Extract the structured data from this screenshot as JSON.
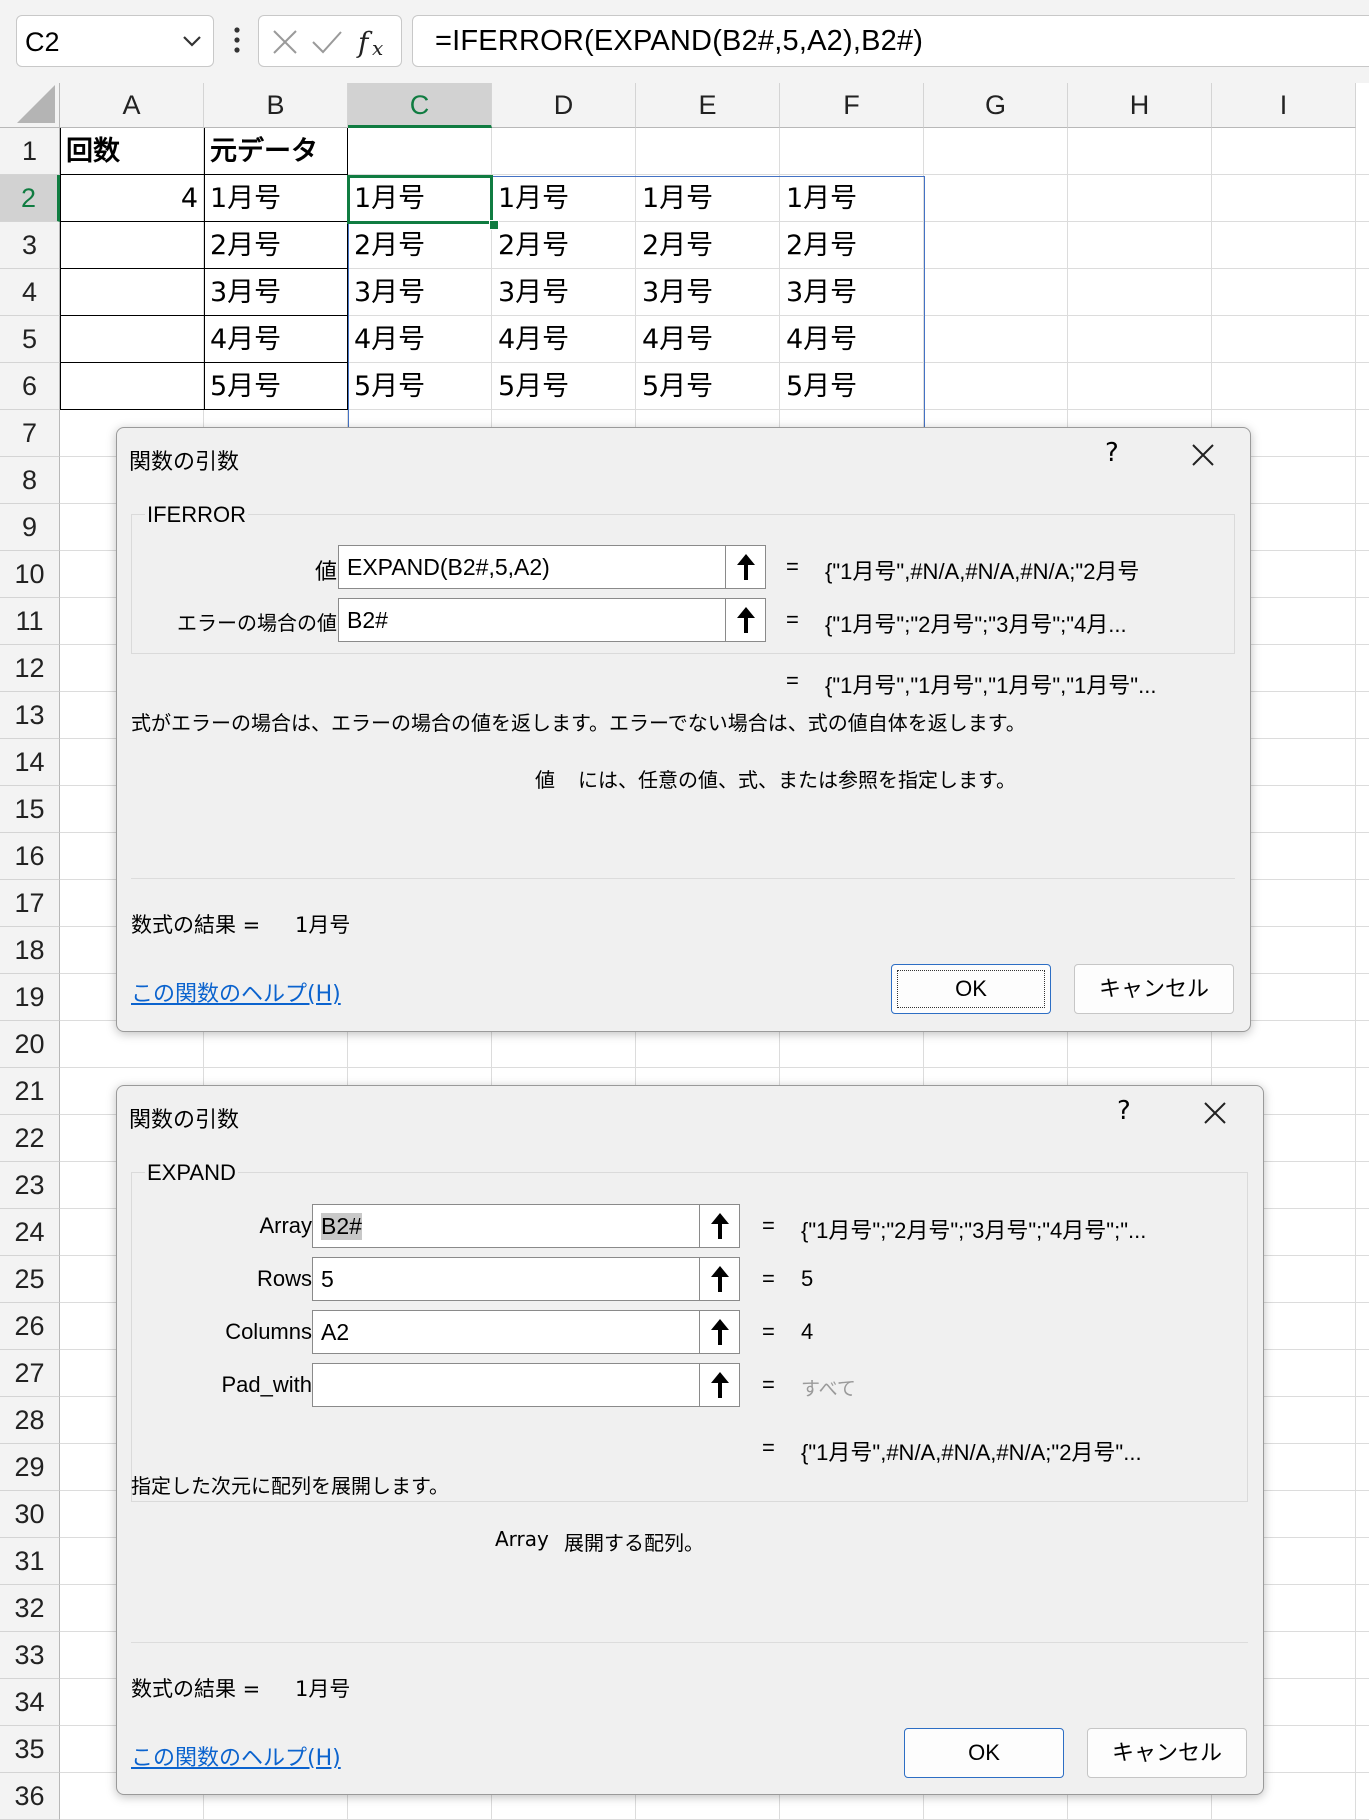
{
  "formula_bar": {
    "name_box": "C2",
    "formula": "=IFERROR(EXPAND(B2#,5,A2),B2#)"
  },
  "columns": [
    "A",
    "B",
    "C",
    "D",
    "E",
    "F",
    "G",
    "H",
    "I"
  ],
  "rows": [
    "1",
    "2",
    "3",
    "4",
    "5",
    "6",
    "7",
    "8",
    "9",
    "10",
    "11",
    "12",
    "13",
    "14",
    "15",
    "16",
    "17",
    "18",
    "19",
    "20",
    "21",
    "22",
    "23",
    "24",
    "25",
    "26",
    "27",
    "28",
    "29",
    "30",
    "31",
    "32",
    "33",
    "34",
    "35",
    "36"
  ],
  "cells": {
    "A1": "回数",
    "B1": "元データ",
    "A2": "4",
    "B2": "1月号",
    "B3": "2月号",
    "B4": "3月号",
    "B5": "4月号",
    "B6": "5月号",
    "spill": [
      [
        "1月号",
        "1月号",
        "1月号",
        "1月号"
      ],
      [
        "2月号",
        "2月号",
        "2月号",
        "2月号"
      ],
      [
        "3月号",
        "3月号",
        "3月号",
        "3月号"
      ],
      [
        "4月号",
        "4月号",
        "4月号",
        "4月号"
      ],
      [
        "5月号",
        "5月号",
        "5月号",
        "5月号"
      ]
    ]
  },
  "dialog1": {
    "title": "関数の引数",
    "help_q": "?",
    "function_name": "IFERROR",
    "args": [
      {
        "label": "値",
        "value": "EXPAND(B2#,5,A2)",
        "eq": "=",
        "result": "{\"1月号\",#N/A,#N/A,#N/A;\"2月号"
      },
      {
        "label": "エラーの場合の値",
        "value": "B2#",
        "eq": "=",
        "result": "{\"1月号\";\"2月号\";\"3月号\";\"4月..."
      }
    ],
    "total_eq": "=",
    "total_result": "{\"1月号\",\"1月号\",\"1月号\",\"1月号\"...",
    "description": "式がエラーの場合は、エラーの場合の値を返します。エラーでない場合は、式の値自体を返します。",
    "arg_desc_name": "値",
    "arg_desc_text": "には、任意の値、式、または参照を指定します。",
    "result_label": "数式の結果 =",
    "result_value": "1月号",
    "help_link": "この関数のヘルプ(H)",
    "ok": "OK",
    "cancel": "キャンセル"
  },
  "dialog2": {
    "title": "関数の引数",
    "help_q": "?",
    "function_name": "EXPAND",
    "args": [
      {
        "label": "Array",
        "value": "B2#",
        "eq": "=",
        "result": "{\"1月号\";\"2月号\";\"3月号\";\"4月号\";\"..."
      },
      {
        "label": "Rows",
        "value": "5",
        "eq": "=",
        "result": "5"
      },
      {
        "label": "Columns",
        "value": "A2",
        "eq": "=",
        "result": "4"
      },
      {
        "label": "Pad_with",
        "value": "",
        "eq": "=",
        "result": "すべて"
      }
    ],
    "total_eq": "=",
    "total_result": "{\"1月号\",#N/A,#N/A,#N/A;\"2月号\"...",
    "description": "指定した次元に配列を展開します。",
    "arg_desc_name": "Array",
    "arg_desc_text": "展開する配列。",
    "result_label": "数式の結果 =",
    "result_value": "1月号",
    "help_link": "この関数のヘルプ(H)",
    "ok": "OK",
    "cancel": "キャンセル"
  }
}
